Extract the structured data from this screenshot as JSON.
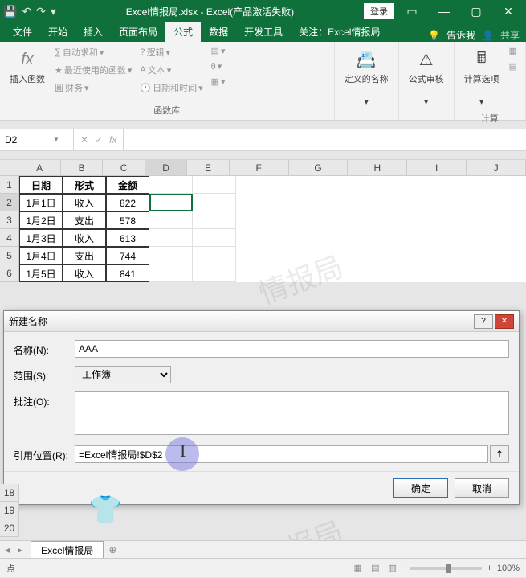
{
  "titlebar": {
    "filename": "Excel情报局.xlsx",
    "app": "Excel(产品激活失败)",
    "login": "登录"
  },
  "tabs": {
    "file": "文件",
    "home": "开始",
    "insert": "插入",
    "layout": "页面布局",
    "formulas": "公式",
    "data": "数据",
    "devtools": "开发工具",
    "about": "关注：Excel情报局",
    "tellme": "告诉我",
    "share": "共享"
  },
  "ribbon": {
    "insert_fn": "插入函数",
    "autosum": "自动求和",
    "recent_fn": "最近使用的函数",
    "financial": "财务",
    "logical": "逻辑",
    "text": "文本",
    "datetime": "日期和时间",
    "group1_label": "函数库",
    "defined_names": "定义的名称",
    "formula_audit": "公式审核",
    "calc_options": "计算选项",
    "group3_label": "计算"
  },
  "namebox": "D2",
  "chart_data": {
    "type": "table",
    "columns": [
      "A",
      "B",
      "C",
      "D",
      "E",
      "F",
      "G",
      "H",
      "I",
      "J"
    ],
    "headers": [
      "日期",
      "形式",
      "金额"
    ],
    "rows": [
      [
        "1月1日",
        "收入",
        822
      ],
      [
        "1月2日",
        "支出",
        578
      ],
      [
        "1月3日",
        "收入",
        613
      ],
      [
        "1月4日",
        "支出",
        744
      ],
      [
        "1月5日",
        "收入",
        841
      ]
    ],
    "selected_cell": "D2"
  },
  "dialog": {
    "title": "新建名称",
    "name_label": "名称(N):",
    "name_value": "AAA",
    "scope_label": "范围(S):",
    "scope_value": "工作簿",
    "comment_label": "批注(O):",
    "comment_value": "",
    "ref_label": "引用位置(R):",
    "ref_value": "=Excel情报局!$D$2",
    "ok": "确定",
    "cancel": "取消"
  },
  "sheet": {
    "name": "Excel情报局"
  },
  "status": {
    "left": "点",
    "zoom": "100%"
  },
  "extra_rows": [
    "18",
    "19",
    "20"
  ],
  "watermark": "情报局"
}
